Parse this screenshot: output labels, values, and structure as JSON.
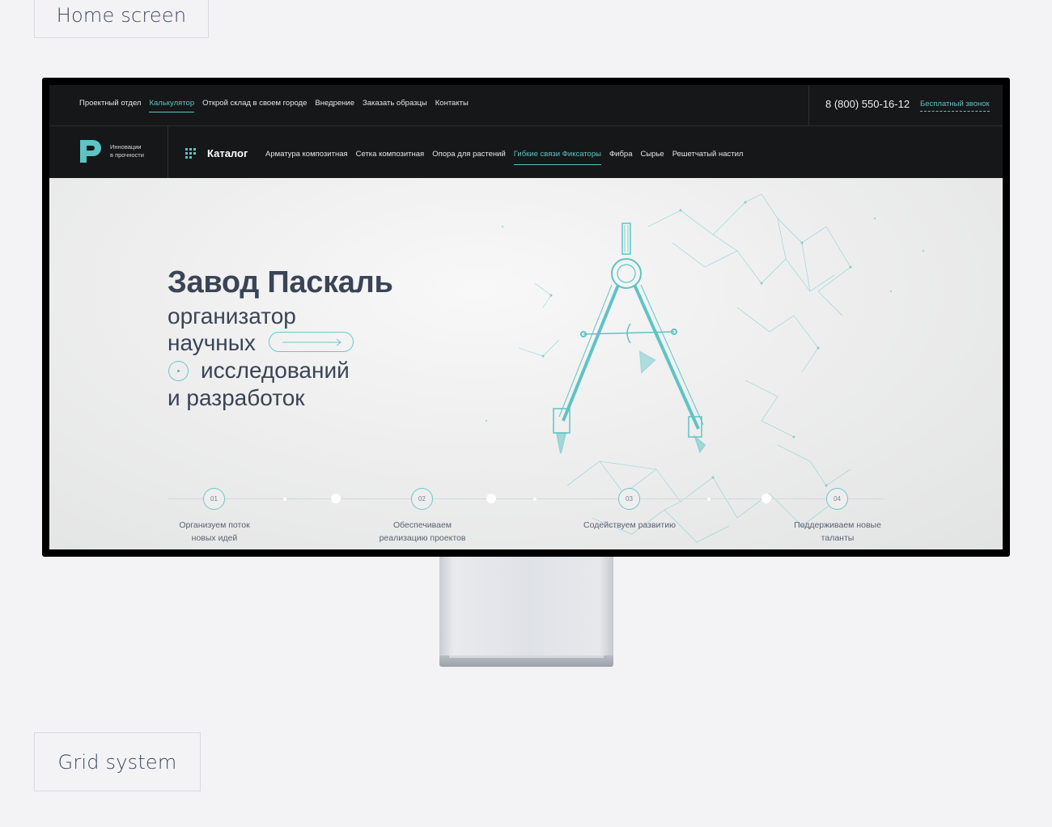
{
  "labels": {
    "home_screen": "Home screen",
    "grid_system": "Grid system"
  },
  "topbar": {
    "nav": [
      {
        "label": "Проектный отдел",
        "active": false
      },
      {
        "label": "Калькулятор",
        "active": true
      },
      {
        "label": "Открой склад в своем городе",
        "active": false
      },
      {
        "label": "Внедрение",
        "active": false
      },
      {
        "label": "Заказать образцы",
        "active": false
      },
      {
        "label": "Контакты",
        "active": false
      }
    ],
    "phone": "8 (800) 550-16-12",
    "callback": "Бесплатный звонок"
  },
  "navbar": {
    "logo_line1": "Инновации",
    "logo_line2": "в прочности",
    "catalog": "Каталог",
    "categories": [
      {
        "label": "Арматура композитная",
        "active": false
      },
      {
        "label": "Сетка композитная",
        "active": false
      },
      {
        "label": "Опора для растений",
        "active": false
      },
      {
        "label": "Гибкие связи Фиксаторы",
        "active": true
      },
      {
        "label": "Фибра",
        "active": false
      },
      {
        "label": "Сырье",
        "active": false
      },
      {
        "label": "Решетчатый настил",
        "active": false
      }
    ]
  },
  "hero": {
    "title": "Завод Паскаль",
    "line1": "организатор",
    "line2": "научных",
    "line3": "исследований",
    "line4": "и разработок"
  },
  "steps": [
    {
      "num": "01",
      "line1": "Организуем поток",
      "line2": "новых идей"
    },
    {
      "num": "02",
      "line1": "Обеспечиваем",
      "line2": "реализацию проектов"
    },
    {
      "num": "03",
      "line1": "Содействуем развитию",
      "line2": ""
    },
    {
      "num": "04",
      "line1": "Поддерживаем новые",
      "line2": "таланты"
    }
  ],
  "colors": {
    "accent": "#5fc3c4",
    "dark": "#161718",
    "heading": "#3a4456"
  }
}
